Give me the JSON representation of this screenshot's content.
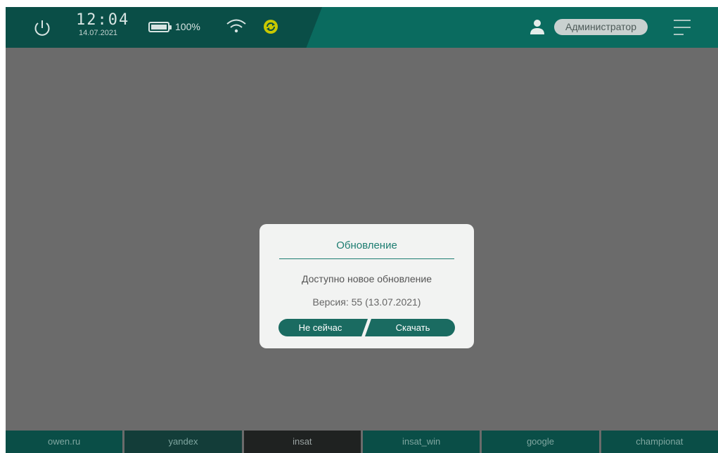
{
  "status": {
    "time": "12:04",
    "date": "14.07.2021",
    "battery_percent": "100%",
    "battery_level": 1.0,
    "user_role": "Администратор",
    "icons": {
      "power": "power-icon",
      "battery": "battery-icon",
      "wifi": "wifi-icon",
      "sync": "sync-icon",
      "user": "user-icon",
      "menu": "menu-icon"
    }
  },
  "dialog": {
    "title": "Обновление",
    "message": "Доступно новое обновление",
    "version": "Версия: 55 (13.07.2021)",
    "cancel_label": "Не сейчас",
    "download_label": "Скачать"
  },
  "tabs": [
    {
      "label": "owen.ru"
    },
    {
      "label": "yandex"
    },
    {
      "label": "insat"
    },
    {
      "label": "insat_win"
    },
    {
      "label": "google"
    },
    {
      "label": "championat"
    }
  ],
  "colors": {
    "status_bar": "#0a6b5f",
    "status_panel": "#0a4e47",
    "accent": "#1d7d71",
    "button": "#1a6b61",
    "overlay": "#6b6b6b"
  }
}
